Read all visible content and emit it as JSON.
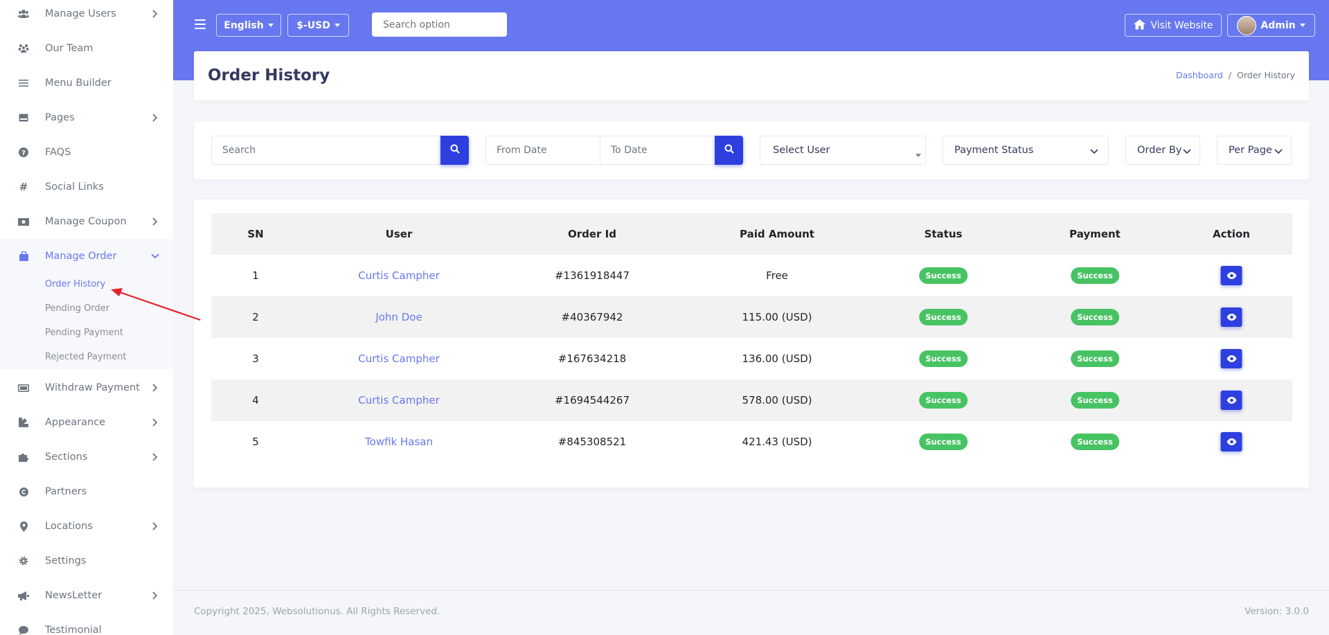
{
  "sidebar": {
    "items": [
      {
        "label": "Manage Users",
        "icon": "users-icon",
        "has_children": true
      },
      {
        "label": "Our Team",
        "icon": "team-icon",
        "has_children": false
      },
      {
        "label": "Menu Builder",
        "icon": "bars-icon",
        "has_children": false
      },
      {
        "label": "Pages",
        "icon": "page-icon",
        "has_children": true
      },
      {
        "label": "FAQS",
        "icon": "question-icon",
        "has_children": false
      },
      {
        "label": "Social Links",
        "icon": "hash-icon",
        "has_children": false
      },
      {
        "label": "Manage Coupon",
        "icon": "coupon-icon",
        "has_children": true
      },
      {
        "label": "Manage Order",
        "icon": "bag-icon",
        "has_children": true,
        "active": true
      },
      {
        "label": "Withdraw Payment",
        "icon": "money-icon",
        "has_children": true
      },
      {
        "label": "Appearance",
        "icon": "palette-icon",
        "has_children": true
      },
      {
        "label": "Sections",
        "icon": "puzzle-icon",
        "has_children": true
      },
      {
        "label": "Partners",
        "icon": "copyright-icon",
        "has_children": false
      },
      {
        "label": "Locations",
        "icon": "map-marker-icon",
        "has_children": true
      },
      {
        "label": "Settings",
        "icon": "gear-icon",
        "has_children": false
      },
      {
        "label": "NewsLetter",
        "icon": "bullhorn-icon",
        "has_children": true
      },
      {
        "label": "Testimonial",
        "icon": "comment-icon",
        "has_children": false
      }
    ],
    "submenu": [
      {
        "label": "Order History",
        "active": true
      },
      {
        "label": "Pending Order"
      },
      {
        "label": "Pending Payment"
      },
      {
        "label": "Rejected Payment"
      }
    ]
  },
  "topbar": {
    "language": "English",
    "currency": "$-USD",
    "search_placeholder": "Search option",
    "visit_website": "Visit Website",
    "admin": "Admin"
  },
  "header": {
    "title": "Order History",
    "breadcrumb": [
      "Dashboard",
      "/",
      "Order History"
    ]
  },
  "filters": {
    "search_placeholder": "Search",
    "from_date_placeholder": "From Date",
    "to_date_placeholder": "To Date",
    "select_user": "Select User",
    "payment_status": "Payment Status",
    "order_by": "Order By",
    "per_page": "Per Page"
  },
  "table": {
    "columns": [
      "SN",
      "User",
      "Order Id",
      "Paid Amount",
      "Status",
      "Payment",
      "Action"
    ],
    "rows": [
      {
        "sn": "1",
        "user": "Curtis Campher",
        "order_id": "#1361918447",
        "paid": "Free",
        "status": "Success",
        "payment": "Success"
      },
      {
        "sn": "2",
        "user": "John Doe",
        "order_id": "#40367942",
        "paid": "115.00 (USD)",
        "status": "Success",
        "payment": "Success"
      },
      {
        "sn": "3",
        "user": "Curtis Campher",
        "order_id": "#167634218",
        "paid": "136.00 (USD)",
        "status": "Success",
        "payment": "Success"
      },
      {
        "sn": "4",
        "user": "Curtis Campher",
        "order_id": "#1694544267",
        "paid": "578.00 (USD)",
        "status": "Success",
        "payment": "Success"
      },
      {
        "sn": "5",
        "user": "Towfik Hasan",
        "order_id": "#845308521",
        "paid": "421.43 (USD)",
        "status": "Success",
        "payment": "Success"
      }
    ]
  },
  "footer": {
    "copyright": "Copyright 2025, Websolutionus. All Rights Reserved.",
    "version": "Version: 3.0.0"
  },
  "colors": {
    "primary": "#6777ef",
    "button": "#2e3fe0",
    "success": "#47c363",
    "annotation_arrow": "#e8202a"
  }
}
